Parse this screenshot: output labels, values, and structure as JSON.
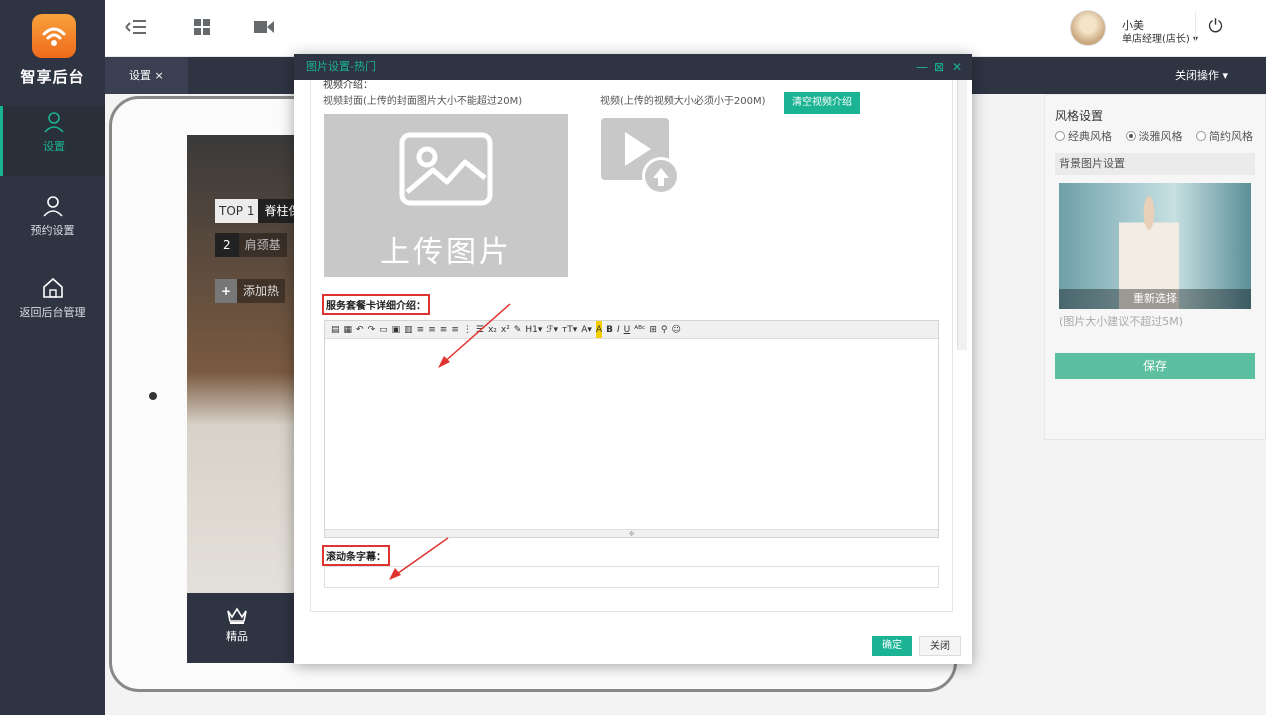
{
  "brand": {
    "name": "智享后台"
  },
  "sidebar": {
    "items": [
      {
        "label": "设置",
        "icon": "user-icon",
        "active": true
      },
      {
        "label": "预约设置",
        "icon": "user-icon",
        "active": false
      },
      {
        "label": "返回后台管理",
        "icon": "home-icon",
        "active": false
      }
    ]
  },
  "topbar": {
    "icons": [
      "menu-toggle-icon",
      "grid-icon",
      "video-camera-icon"
    ],
    "user": {
      "name": "小美",
      "role": "单店经理(店长)"
    }
  },
  "tabs": {
    "items": [
      {
        "label": "设置 ×"
      }
    ],
    "right_label": "关闭操作"
  },
  "preview": {
    "hot_list": [
      {
        "rank": "TOP 1",
        "text": "脊柱保"
      },
      {
        "rank": "2",
        "text": "肩颈基"
      }
    ],
    "add_label": "添加热",
    "footer_label": "精品"
  },
  "right_panel": {
    "title": "风格设置",
    "styles": [
      {
        "label": "经典风格",
        "checked": false
      },
      {
        "label": "淡雅风格",
        "checked": true
      },
      {
        "label": "简约风格",
        "checked": false
      }
    ],
    "bg_title": "背景图片设置",
    "reselect": "重新选择",
    "hint": "(图片大小建议不超过5M)",
    "save": "保存"
  },
  "modal": {
    "title": "图片设置-热门",
    "controls": {
      "minimize": "—",
      "maximize": "⊠",
      "close": "✕"
    },
    "cut_label": "视频介绍：",
    "cover_label": "视频封面(上传的封面图片大小不能超过20M)",
    "video_label": "视频(上传的视频大小必须小于200M)",
    "clear_video": "清空视频介绍",
    "upload_text": "上传图片",
    "detail_label": "服务套餐卡详细介绍：",
    "marquee_label": "滚动条字幕：",
    "ok": "确定",
    "close": "关闭"
  },
  "colors": {
    "accent": "#1ab394",
    "sidebar_bg": "#2f3443",
    "highlight": "#e0332f"
  }
}
